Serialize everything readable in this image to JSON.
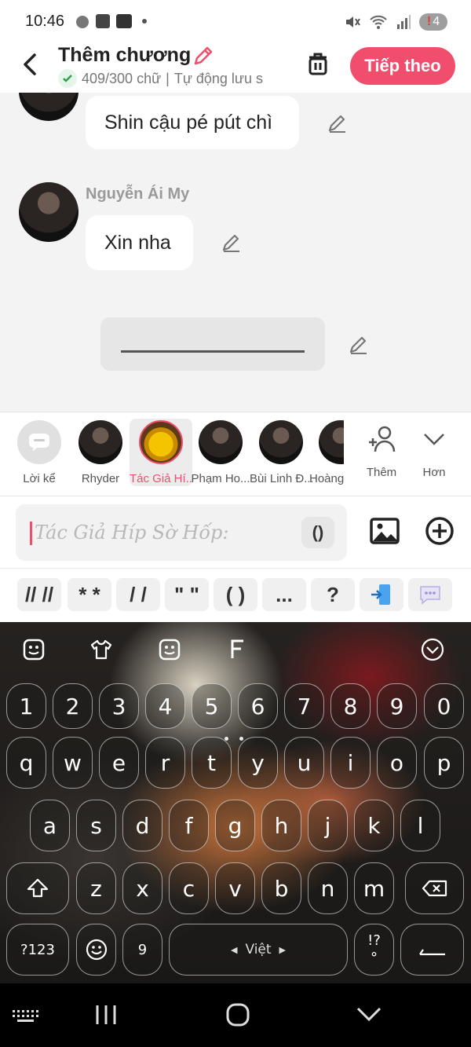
{
  "status_bar": {
    "time": "10:46",
    "battery": "4",
    "battery_alert": "!"
  },
  "header": {
    "title": "Thêm chương",
    "word_count": "409/300 chữ",
    "separator": "|",
    "autosave": "Tự động lưu s",
    "next_label": "Tiếp theo"
  },
  "chat": {
    "messages": [
      {
        "text": "Shin cậu pé pút chì"
      },
      {
        "sender": "Nguyễn Ái My",
        "text": "Xin nha"
      }
    ]
  },
  "characters": [
    {
      "name": "Lời kể"
    },
    {
      "name": "Rhyder"
    },
    {
      "name": "Tác Giả Hí..."
    },
    {
      "name": "Phạm Ho..."
    },
    {
      "name": "Bùi Linh Đ..."
    },
    {
      "name": "Hoàng"
    },
    {
      "name": "Thêm"
    },
    {
      "name": "Hơn"
    }
  ],
  "input": {
    "placeholder": "Tác Giả Híp Sờ Hốp:",
    "paren_button": "()"
  },
  "chips": [
    "// //",
    "* *",
    "/ /",
    "\" \"",
    "( )",
    "...",
    "?"
  ],
  "keyboard": {
    "numbers": [
      "1",
      "2",
      "3",
      "4",
      "5",
      "6",
      "7",
      "8",
      "9",
      "0"
    ],
    "row1": [
      "q",
      "w",
      "e",
      "r",
      "t",
      "y",
      "u",
      "i",
      "o",
      "p"
    ],
    "row2": [
      "a",
      "s",
      "d",
      "f",
      "g",
      "h",
      "j",
      "k",
      "l"
    ],
    "row3": [
      "z",
      "x",
      "c",
      "v",
      "b",
      "n",
      "m"
    ],
    "symbols_key": "?123",
    "comma_key": "9",
    "space_label": "Việt",
    "punct_top": "!?",
    "punct_bottom": "°"
  },
  "colors": {
    "accent": "#f04e6c",
    "chat_bg": "#f3f3f3"
  }
}
